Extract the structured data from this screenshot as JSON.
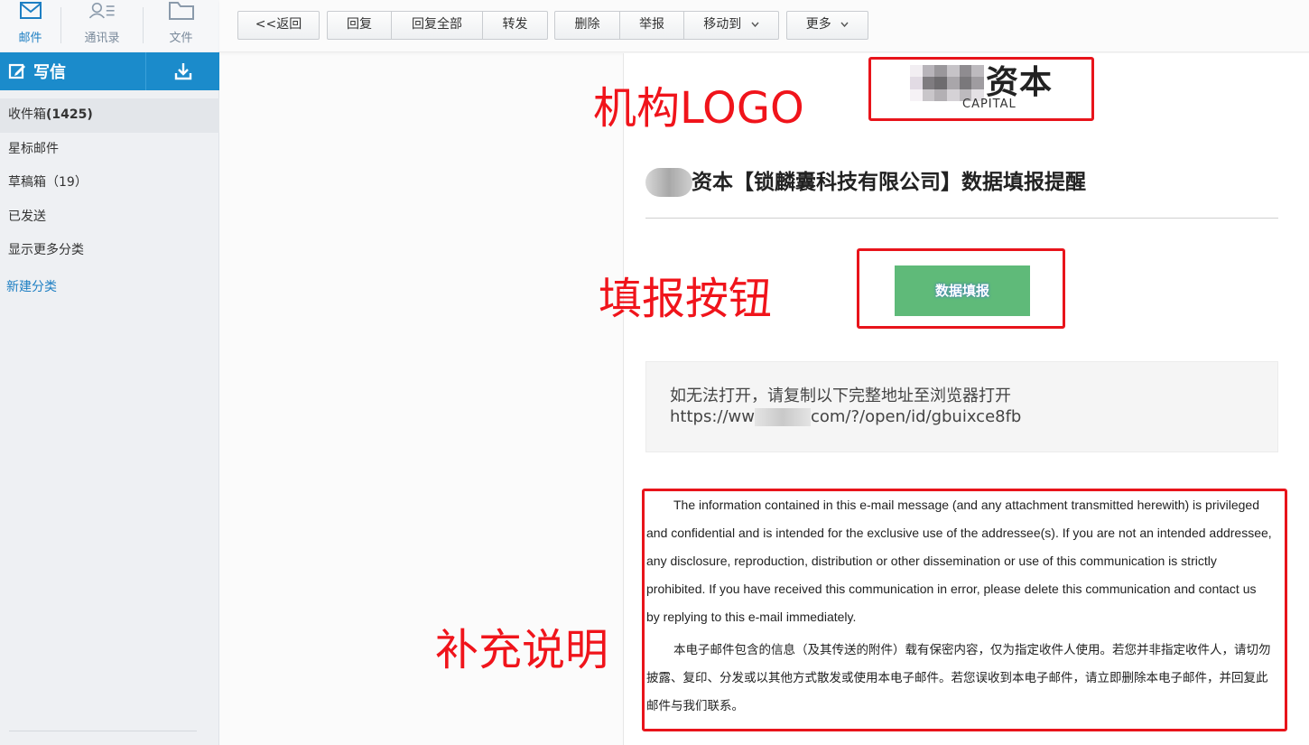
{
  "nav": {
    "mail": "邮件",
    "contacts": "通讯录",
    "files": "文件"
  },
  "compose": {
    "label": "写信"
  },
  "folders": {
    "inbox_label": "收件箱",
    "inbox_count": "(1425)",
    "starred": "星标邮件",
    "drafts": "草稿箱（19）",
    "sent": "已发送",
    "more": "显示更多分类",
    "new_category": "新建分类"
  },
  "toolbar": {
    "back": "<<返回",
    "reply": "回复",
    "reply_all": "回复全部",
    "forward": "转发",
    "delete": "删除",
    "report": "举报",
    "move_to": "移动到",
    "more": "更多"
  },
  "mail": {
    "logo_cn": "资本",
    "logo_en": "CAPITAL",
    "title": "资本【锁麟囊科技有限公司】数据填报提醒",
    "fill_button": "数据填报",
    "link_hint": "如无法打开，请复制以下完整地址至浏览器打开",
    "link_prefix": "https://ww",
    "link_suffix": "com/?/open/id/gbuixce8fb",
    "disclaimer_en": "The information contained in this e-mail message (and any attachment transmitted herewith) is privileged and confidential and is intended for the exclusive use of the addressee(s). If you are not an intended addressee, any disclosure, reproduction, distribution or other dissemination or use of this communication is strictly prohibited. If you have received this communication in error, please delete this communication and contact us by replying to this e-mail immediately.",
    "disclaimer_cn": "本电子邮件包含的信息（及其传送的附件）载有保密内容，仅为指定收件人使用。若您并非指定收件人，请切勿披露、复印、分发或以其他方式散发或使用本电子邮件。若您误收到本电子邮件，请立即删除本电子邮件，并回复此邮件与我们联系。"
  },
  "annotations": {
    "logo": "机构LOGO",
    "button": "填报按钮",
    "note": "补充说明"
  },
  "colors": {
    "accent": "#1b8bcb",
    "button_green": "#5fba79",
    "annotation_red": "#e8141b"
  }
}
